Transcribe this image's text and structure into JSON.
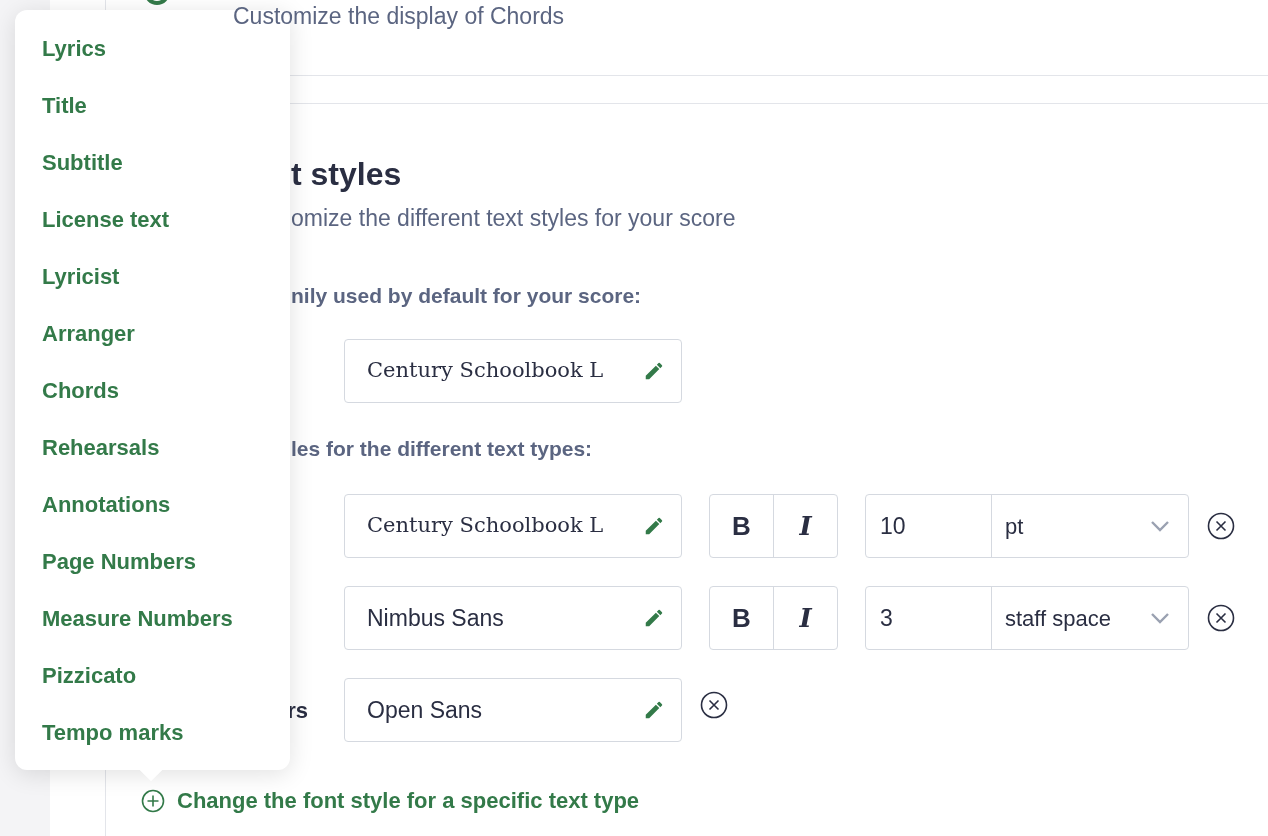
{
  "header": {
    "description": "Customize the display of Chords"
  },
  "section": {
    "title": "t styles",
    "subtitle": "omize the different text styles for your score",
    "default_font_label": "nily used by default for your score:",
    "default_font": {
      "value": "Century Schoolbook L",
      "kind": "serif"
    },
    "text_types_label": "les for the different text types:",
    "text_types": [
      {
        "kind": "full",
        "font": {
          "value": "Century Schoolbook L",
          "kind": "serif"
        },
        "bold_label": "B",
        "italic_label": "I",
        "size": "10",
        "unit": "pt"
      },
      {
        "kind": "full",
        "font": {
          "value": "Nimbus Sans",
          "kind": "sans"
        },
        "bold_label": "B",
        "italic_label": "I",
        "size": "3",
        "unit": "staff space"
      },
      {
        "kind": "font_only",
        "label": "rs",
        "font": {
          "value": "Open Sans",
          "kind": "sans"
        }
      }
    ]
  },
  "add_link": "Change the font style for a specific text type",
  "menu": {
    "items": [
      "Lyrics",
      "Title",
      "Subtitle",
      "License text",
      "Lyricist",
      "Arranger",
      "Chords",
      "Rehearsals",
      "Annotations",
      "Page Numbers",
      "Measure Numbers",
      "Pizzicato",
      "Tempo marks"
    ]
  }
}
